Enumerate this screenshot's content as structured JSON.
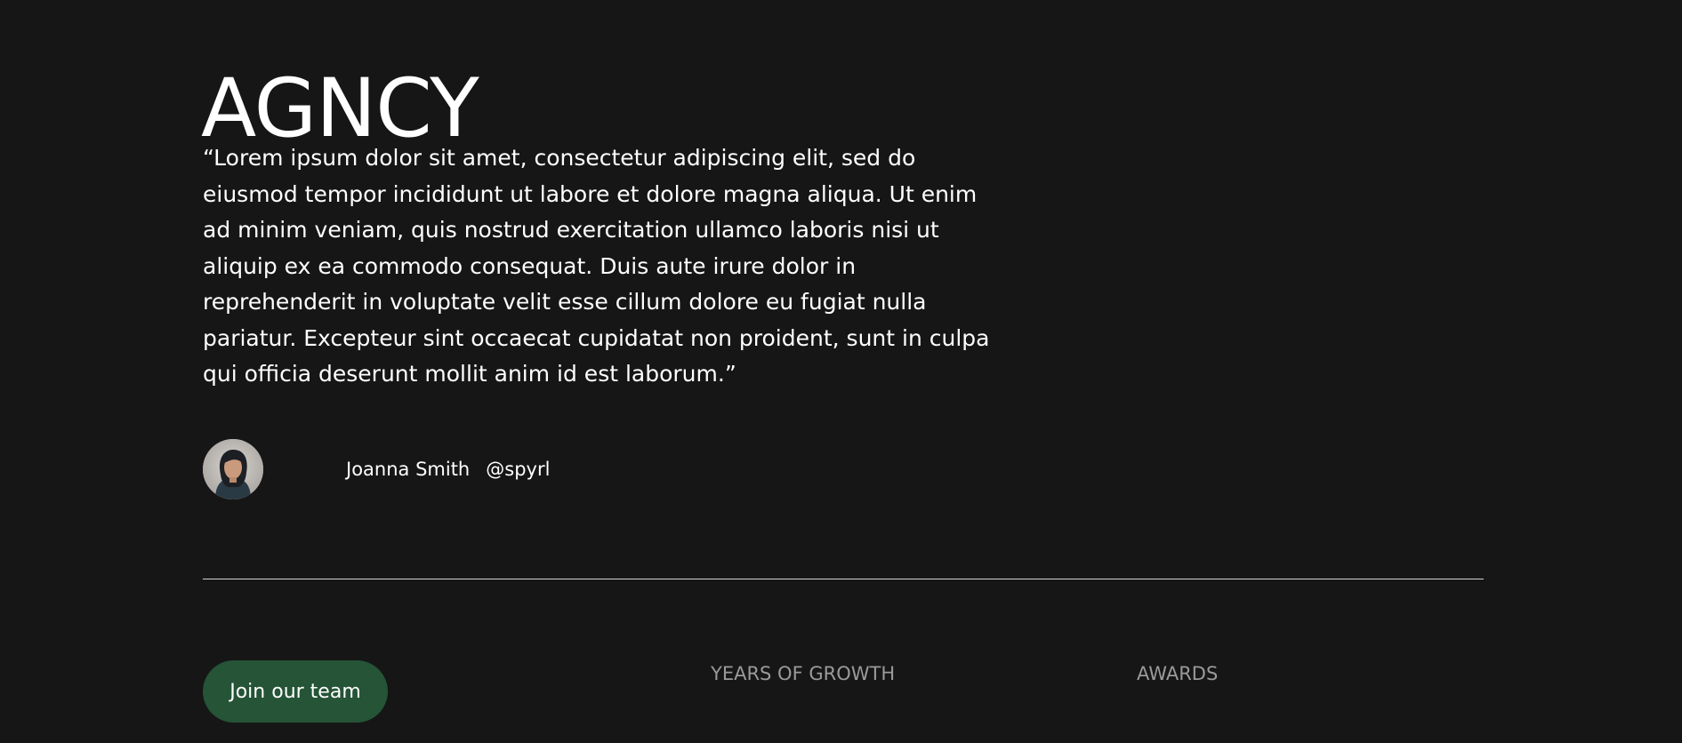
{
  "brand": {
    "name": "AGNCY"
  },
  "testimonial": {
    "quote": "“Lorem ipsum dolor sit amet, consectetur adipiscing elit, sed do eiusmod tempor incididunt ut labore et dolore magna aliqua. Ut enim ad minim veniam, quis nostrud exercitation ullamco laboris nisi ut aliquip ex ea commodo consequat. Duis aute irure dolor in reprehenderit in voluptate velit esse cillum dolore eu fugiat nulla pariatur. Excepteur sint occaecat cupidatat non proident, sunt in culpa qui officia deserunt mollit anim id est laborum.”",
    "author_name": "Joanna Smith",
    "author_handle": "@spyrl",
    "avatar_icon": "person-portrait-icon"
  },
  "cta": {
    "join_label": "Join our team",
    "color": "#255436"
  },
  "stats": {
    "years_label": "YEARS OF GROWTH",
    "awards_label": "AWARDS"
  },
  "colors": {
    "background": "#161616",
    "text": "#ffffff",
    "muted": "#9a9a9a",
    "divider": "#d4d4d4"
  }
}
